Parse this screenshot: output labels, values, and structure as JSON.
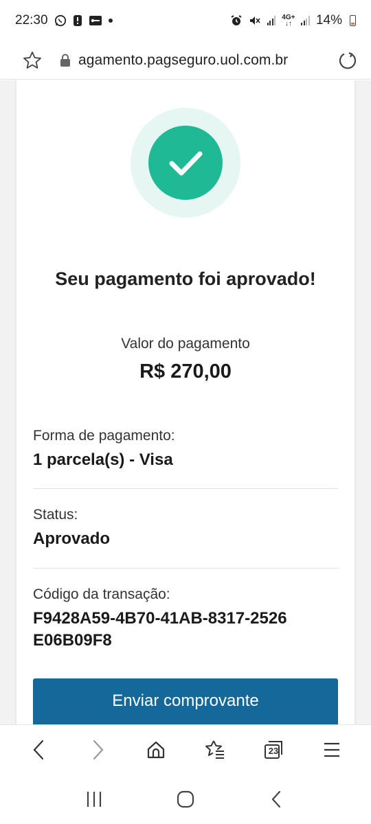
{
  "status_bar": {
    "time": "22:30",
    "battery": "14%",
    "network": "4G+",
    "left_icons": [
      "whatsapp-icon",
      "alert-icon",
      "key-icon",
      "dot"
    ],
    "right_icons": [
      "alarm-icon",
      "mute-icon",
      "signal-icon",
      "4g-icon",
      "signal-icon",
      "battery-icon"
    ]
  },
  "address_bar": {
    "url": "agamento.pagseguro.uol.com.br",
    "icons": [
      "star-icon",
      "lock-icon",
      "reload-icon"
    ]
  },
  "confirmation": {
    "title": "Seu pagamento foi aprovado!",
    "amount_label": "Valor do pagamento",
    "amount_value": "R$ 270,00",
    "accent_color": "#1fb996",
    "fields": [
      {
        "label": "Forma de pagamento:",
        "value": "1 parcela(s) - Visa"
      },
      {
        "label": "Status:",
        "value": "Aprovado"
      },
      {
        "label": "Código da transação:",
        "value": "F9428A59-4B70-41AB-8317-2526E06B09F8"
      }
    ],
    "send_button": "Enviar comprovante",
    "button_color": "#14699a"
  },
  "browser_toolbar": {
    "tabs_count": "23",
    "icons": [
      "back-icon",
      "forward-icon",
      "home-icon",
      "bookmarks-icon",
      "tabs-icon",
      "menu-icon"
    ]
  },
  "nav_bar": {
    "icons": [
      "recents-icon",
      "home-button-icon",
      "back-nav-icon"
    ]
  }
}
